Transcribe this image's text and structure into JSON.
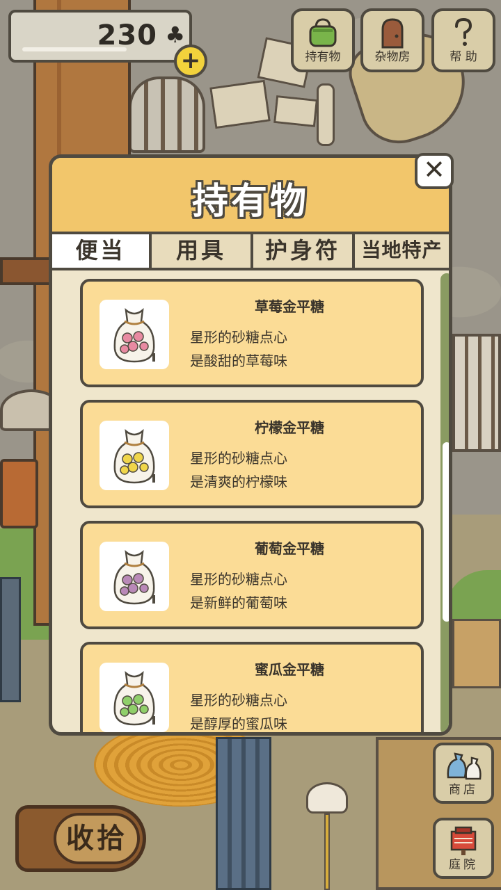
{
  "hud": {
    "clover_count": "230",
    "clover_icon": "clover-icon",
    "plus_label": "+"
  },
  "top_buttons": {
    "inventory": {
      "label": "持有物",
      "icon": "green-bag-icon"
    },
    "storeroom": {
      "label": "杂物房",
      "icon": "door-icon"
    },
    "help": {
      "label": "帮 助",
      "icon": "question-mark-icon"
    }
  },
  "side_buttons": {
    "shop": {
      "label": "商店",
      "icon": "shop-bags-icon"
    },
    "yard": {
      "label": "庭院",
      "icon": "mailbox-icon"
    }
  },
  "collect_button": {
    "label": "收拾"
  },
  "modal": {
    "title": "持有物",
    "close_label": "✕",
    "tabs": [
      "便当",
      "用具",
      "护身符",
      "当地特产"
    ],
    "active_tab": 0,
    "items": [
      {
        "name": "草莓金平糖",
        "desc1": "星形的砂糖点心",
        "desc2": "是酸甜的草莓味",
        "candy_color": "#e88aa2"
      },
      {
        "name": "柠檬金平糖",
        "desc1": "星形的砂糖点心",
        "desc2": "是清爽的柠檬味",
        "candy_color": "#f0d64a"
      },
      {
        "name": "葡萄金平糖",
        "desc1": "星形的砂糖点心",
        "desc2": "是新鲜的葡萄味",
        "candy_color": "#b989b8"
      },
      {
        "name": "蜜瓜金平糖",
        "desc1": "星形的砂糖点心",
        "desc2": "是醇厚的蜜瓜味",
        "candy_color": "#8fcf6a"
      }
    ],
    "scroll_position": 0.6
  },
  "colors": {
    "modal_header": "#f2c66b",
    "item_card": "#fbdc96",
    "outline": "#4f4a40",
    "scrollbar": "#8a9b62"
  }
}
